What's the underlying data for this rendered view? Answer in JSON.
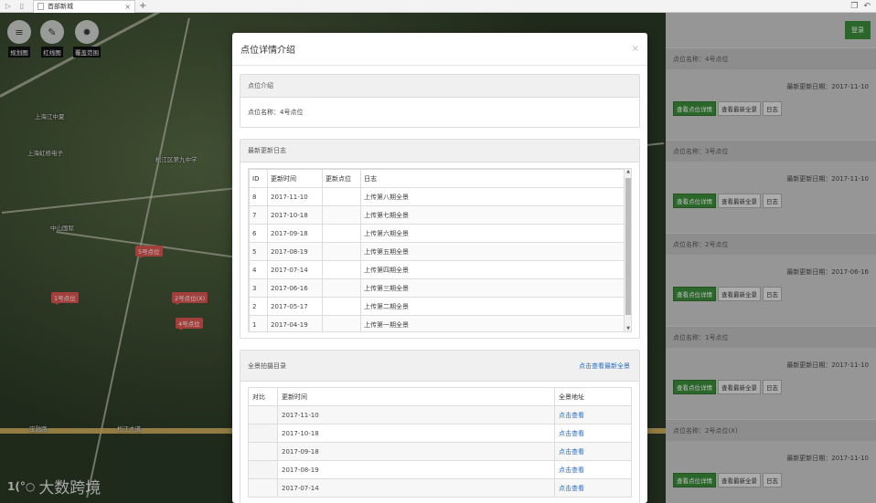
{
  "browser": {
    "tab_title": "首部新城"
  },
  "map": {
    "tools": [
      {
        "label": "规划图",
        "icon": "menu-icon"
      },
      {
        "label": "红线图",
        "icon": "pencil-icon"
      },
      {
        "label": "覆盖范围",
        "icon": "settings-icon"
      }
    ],
    "markers": [
      "5号点位",
      "1号点位",
      "2号点位(X)",
      "4号点位"
    ],
    "place_labels": [
      "上海江中夏",
      "上海虹桥电子",
      "松江区第九中学",
      "中山国际",
      "宝融路",
      "松江大道"
    ],
    "watermark": "大数跨境"
  },
  "right_panel": {
    "login": "登录",
    "points": [
      {
        "name": "点位名称：4号点位",
        "date": "最新更新日期：2017-11-10"
      },
      {
        "name": "点位名称：3号点位",
        "date": "最新更新日期：2017-11-10"
      },
      {
        "name": "点位名称：2号点位",
        "date": "最新更新日期：2017-06-16"
      },
      {
        "name": "点位名称：1号点位",
        "date": "最新更新日期：2017-11-10"
      },
      {
        "name": "点位名称：2号点位(X)",
        "date": "最新更新日期：2017-11-10"
      }
    ],
    "buttons": {
      "detail": "查看点位详情",
      "latest": "查看最新全景",
      "log": "日志"
    }
  },
  "modal": {
    "title": "点位详情介绍",
    "intro": {
      "heading": "点位介绍",
      "name": "点位名称：4号点位"
    },
    "log": {
      "heading": "最新更新日志",
      "columns": [
        "ID",
        "更新时间",
        "更新点位",
        "日志"
      ],
      "rows": [
        [
          "8",
          "2017-11-10",
          "",
          "上传第八期全景"
        ],
        [
          "7",
          "2017-10-18",
          "",
          "上传第七期全景"
        ],
        [
          "6",
          "2017-09-18",
          "",
          "上传第六期全景"
        ],
        [
          "5",
          "2017-08-19",
          "",
          "上传第五期全景"
        ],
        [
          "4",
          "2017-07-14",
          "",
          "上传第四期全景"
        ],
        [
          "3",
          "2017-06-16",
          "",
          "上传第三期全景"
        ],
        [
          "2",
          "2017-05-17",
          "",
          "上传第二期全景"
        ],
        [
          "1",
          "2017-04-19",
          "",
          "上传第一期全景"
        ]
      ]
    },
    "pano": {
      "heading": "全景拍摄目录",
      "latest_link": "点击查看最新全景",
      "columns": [
        "对比",
        "更新时间",
        "全景地址"
      ],
      "rows": [
        [
          "",
          "2017-11-10",
          "点击查看"
        ],
        [
          "",
          "2017-10-18",
          "点击查看"
        ],
        [
          "",
          "2017-09-18",
          "点击查看"
        ],
        [
          "",
          "2017-08-19",
          "点击查看"
        ],
        [
          "",
          "2017-07-14",
          "点击查看"
        ]
      ]
    }
  }
}
